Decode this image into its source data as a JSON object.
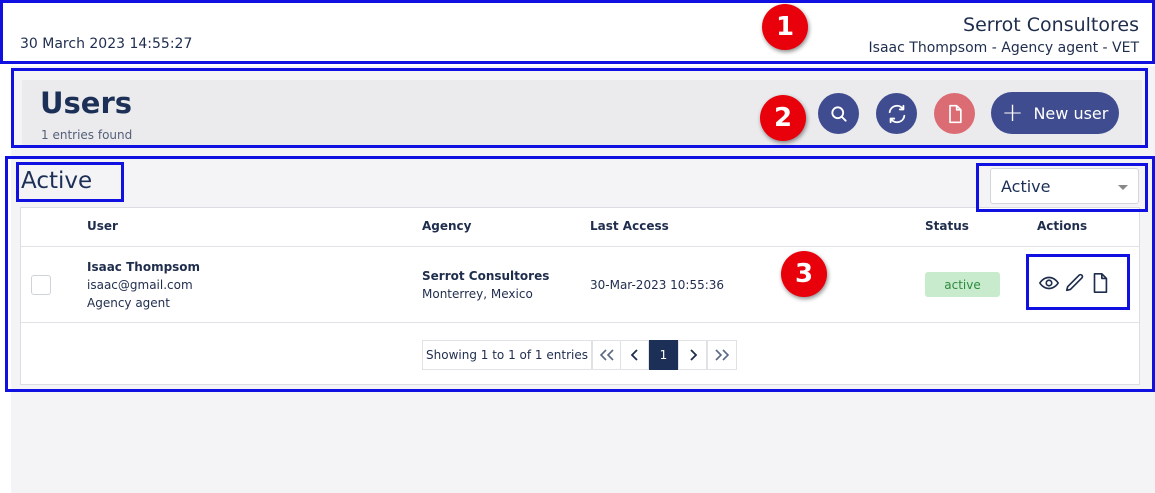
{
  "topbar": {
    "date": "30 March 2023 14:55:27",
    "company": "Serrot Consultores",
    "user_info": "Isaac Thompsom - Agency agent - VET"
  },
  "header": {
    "title": "Users",
    "entries_found": "1 entries found",
    "new_user_label": "New user"
  },
  "annotations": [
    "1",
    "2",
    "3"
  ],
  "section": {
    "title": "Active",
    "filter_selected": "Active"
  },
  "table": {
    "columns": [
      "User",
      "Agency",
      "Last Access",
      "Status",
      "Actions"
    ],
    "rows": [
      {
        "user_name": "Isaac Thompsom",
        "user_email": "isaac@gmail.com",
        "user_role": "Agency agent",
        "agency_name": "Serrot Consultores",
        "agency_location": "Monterrey, Mexico",
        "last_access": "30-Mar-2023 10:55:36",
        "status": "active"
      }
    ]
  },
  "pagination": {
    "summary": "Showing 1 to 1 of 1 entries",
    "current_page": "1"
  },
  "colors": {
    "accent": "#3f4c8f",
    "danger_soft": "#dc6c73",
    "annotation_frame": "#1010e0",
    "annotation_badge": "#e8000b",
    "status_active_bg": "#c7ebcc",
    "status_active_text": "#2e8a3e"
  },
  "icons": [
    "search-icon",
    "refresh-icon",
    "file-icon",
    "plus-icon",
    "eye-icon",
    "pencil-icon",
    "document-icon",
    "double-chevron-left-icon",
    "chevron-left-icon",
    "chevron-right-icon",
    "double-chevron-right-icon",
    "caret-down-icon"
  ]
}
